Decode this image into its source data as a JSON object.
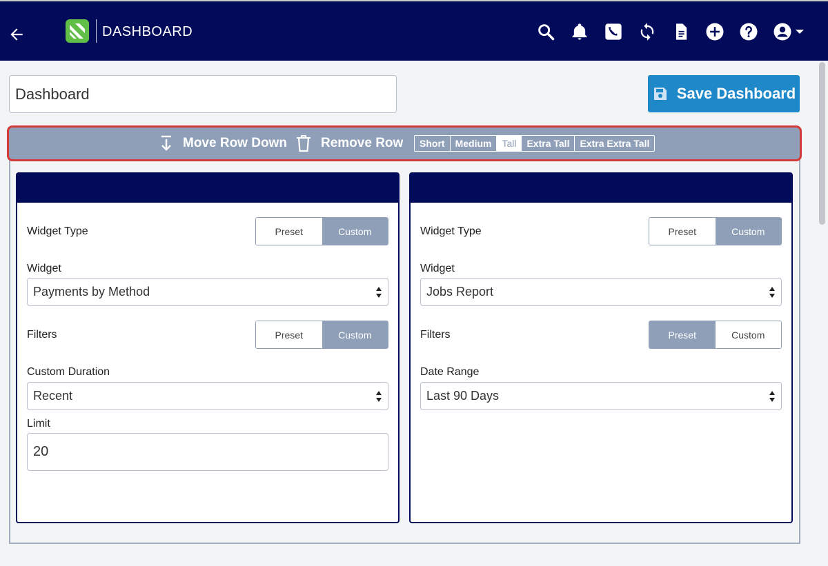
{
  "header": {
    "title": "DASHBOARD",
    "colors": {
      "bar": "#020a5a",
      "logo": "#5fbf47"
    },
    "icons": [
      "back-arrow-icon",
      "search-icon",
      "bell-icon",
      "phone-icon",
      "sync-icon",
      "document-icon",
      "add-circle-icon",
      "help-icon",
      "account-icon",
      "caret-down-icon"
    ]
  },
  "dashboard": {
    "name_value": "Dashboard",
    "save_label": "Save Dashboard",
    "save_color": "#1f88c8"
  },
  "toolbar": {
    "move_row_down": "Move Row Down",
    "remove_row": "Remove Row",
    "sizes": [
      "Short",
      "Medium",
      "Tall",
      "Extra Tall",
      "Extra Extra Tall"
    ],
    "active_size": "Tall",
    "color": "#8f9fb8",
    "highlight_color": "#d43a3a"
  },
  "widgets": [
    {
      "widget_type_label": "Widget Type",
      "widget_type_options": [
        "Preset",
        "Custom"
      ],
      "widget_type_selected": "Custom",
      "widget_label": "Widget",
      "widget_value": "Payments by Method",
      "filters_label": "Filters",
      "filters_options": [
        "Preset",
        "Custom"
      ],
      "filters_selected": "Custom",
      "duration_label": "Custom Duration",
      "duration_value": "Recent",
      "limit_label": "Limit",
      "limit_value": "20"
    },
    {
      "widget_type_label": "Widget Type",
      "widget_type_options": [
        "Preset",
        "Custom"
      ],
      "widget_type_selected": "Custom",
      "widget_label": "Widget",
      "widget_value": "Jobs Report",
      "filters_label": "Filters",
      "filters_options": [
        "Preset",
        "Custom"
      ],
      "filters_selected": "Preset",
      "date_range_label": "Date Range",
      "date_range_value": "Last 90 Days"
    }
  ]
}
